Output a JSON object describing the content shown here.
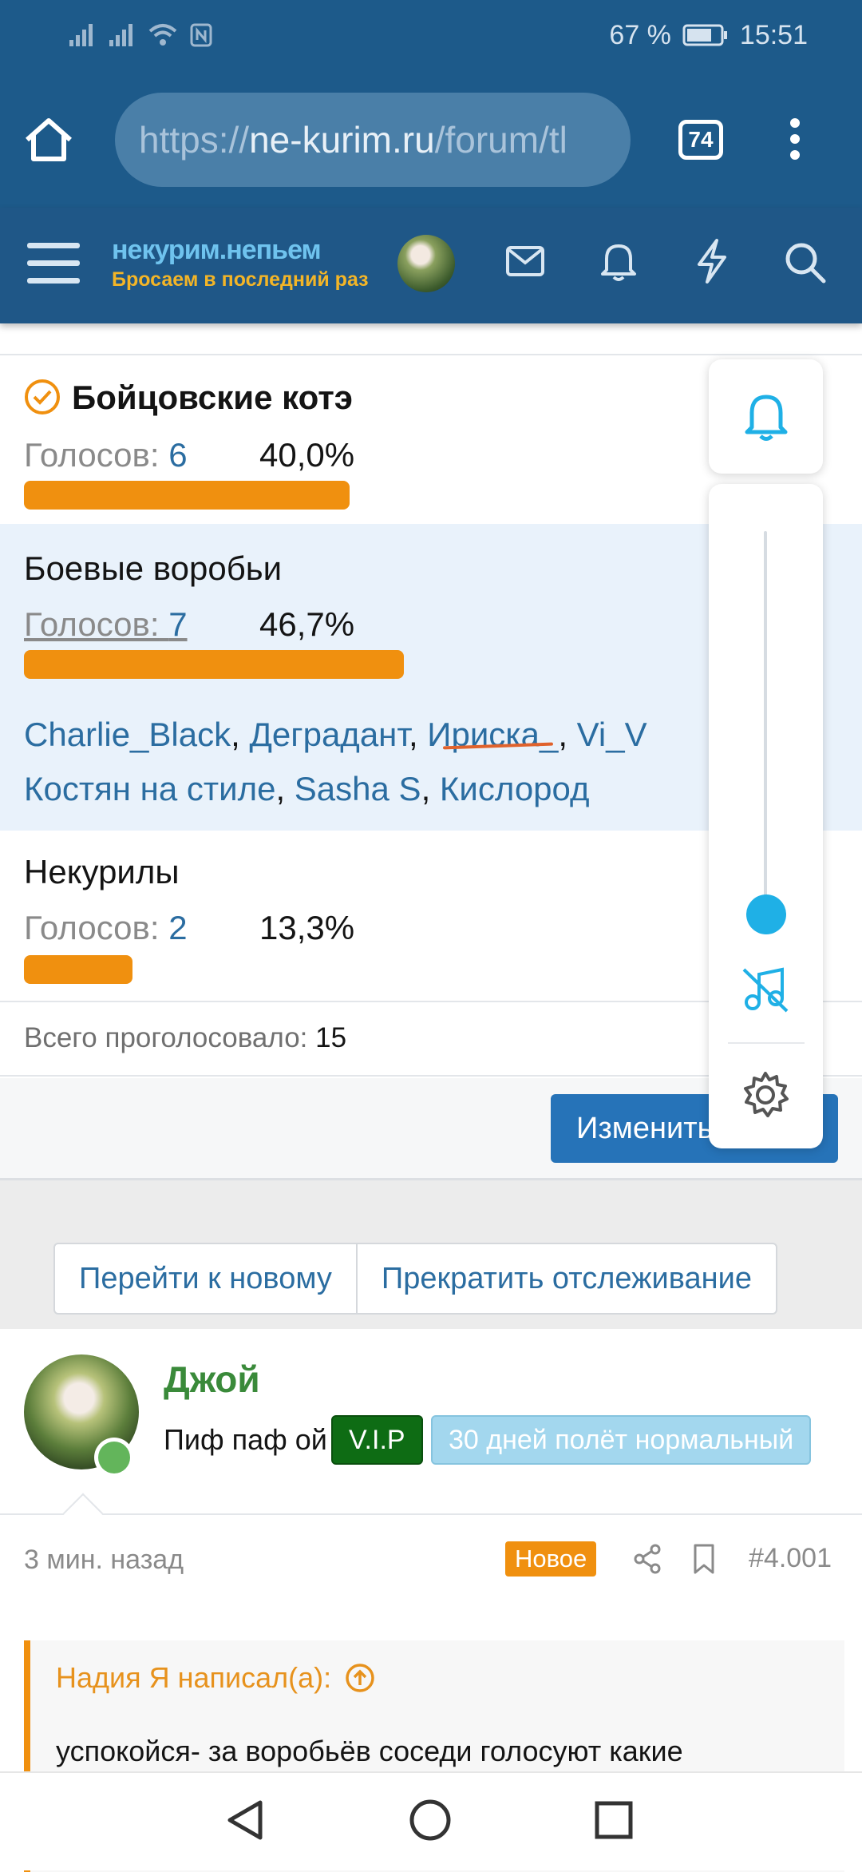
{
  "status_bar": {
    "battery": "67 %",
    "time": "15:51"
  },
  "browser": {
    "url_scheme": "https://",
    "url_host": "ne-kurim.ru",
    "url_path": "/forum/tl",
    "tab_count": "74"
  },
  "site": {
    "logo_line1": "некурим.непьем",
    "logo_line2": "Бросаем в последний раз"
  },
  "poll": {
    "options": [
      {
        "title": "Бойцовские котэ",
        "votes_label": "Голосов:",
        "votes": "6",
        "percent": "40,0%",
        "fraction": 0.4,
        "voted": true
      },
      {
        "title": "Боевые воробьи",
        "votes_label": "Голосов:",
        "votes": "7",
        "percent": "46,7%",
        "fraction": 0.467,
        "voted": false,
        "voters_line1": [
          "Charlie_Black",
          "Деградант",
          "Ириска_",
          "Vi_V"
        ],
        "voters_line2": [
          "Костян на стиле",
          "Sasha S",
          "Кислород"
        ]
      },
      {
        "title": "Некурилы",
        "votes_label": "Голосов:",
        "votes": "2",
        "percent": "13,3%",
        "fraction": 0.133,
        "voted": false
      }
    ],
    "total_label": "Всего проголосовало:",
    "total": "15",
    "change_button": "Изменить"
  },
  "thread_actions": {
    "go_new": "Перейти к новому",
    "unwatch": "Прекратить отслеживание"
  },
  "post": {
    "username": "Джой",
    "user_title": "Пиф паф ой",
    "badge_vip": "V.I.P",
    "badge_days": "30 дней полёт нормальный",
    "time": "3 мин. назад",
    "new_badge": "Новое",
    "post_number": "#4.001",
    "quote_author": "Надия Я написал(а):",
    "quote_text": "успокойся- за воробьёв соседи голосуют какие"
  },
  "colors": {
    "header": "#1f5787",
    "bar": "#f0900f",
    "link": "#2b6da1",
    "accent_cyan": "#1fb0e6"
  }
}
